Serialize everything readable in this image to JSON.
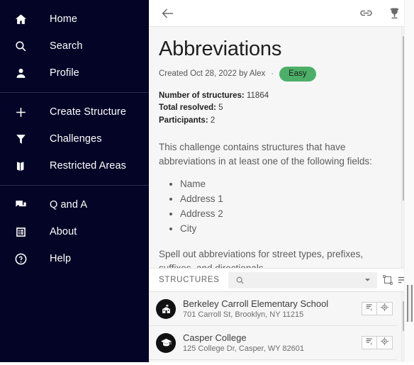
{
  "sidebar": {
    "groups": [
      {
        "items": [
          {
            "label": "Home",
            "icon": "home-icon"
          },
          {
            "label": "Search",
            "icon": "search-icon"
          },
          {
            "label": "Profile",
            "icon": "person-icon"
          }
        ]
      },
      {
        "items": [
          {
            "label": "Create Structure",
            "icon": "plus-icon"
          },
          {
            "label": "Challenges",
            "icon": "funnel-icon"
          },
          {
            "label": "Restricted Areas",
            "icon": "map-icon"
          }
        ]
      },
      {
        "items": [
          {
            "label": "Q and A",
            "icon": "chat-icon"
          },
          {
            "label": "About",
            "icon": "list-box-icon"
          },
          {
            "label": "Help",
            "icon": "help-circle-icon"
          }
        ]
      }
    ]
  },
  "topbar": {
    "back_icon": "back-arrow-icon",
    "link_icon": "link-icon",
    "trophy_icon": "trophy-icon"
  },
  "challenge": {
    "title": "Abbreviations",
    "created_text": "Created Oct 28, 2022 by Alex",
    "separator": "·",
    "difficulty": "Easy",
    "difficulty_color": "#4caf68",
    "stats": [
      {
        "label": "Number of structures:",
        "value": "11864"
      },
      {
        "label": "Total resolved:",
        "value": "5"
      },
      {
        "label": "Participants:",
        "value": "2"
      }
    ],
    "description_intro": "This challenge contains structures that have abbreviations in at least one of the following fields:",
    "fields": [
      "Name",
      "Address 1",
      "Address 2",
      "City"
    ],
    "description_outro": "Spell out abbreviations for street types, prefixes, suffixes, and directionals."
  },
  "structures": {
    "section_label": "STRUCTURES",
    "search_value": "",
    "search_placeholder": "",
    "search_icon": "search-icon",
    "dropdown_icon": "chevron-down-icon",
    "tools": [
      {
        "icon": "select-shape-icon"
      },
      {
        "icon": "sort-list-icon"
      },
      {
        "icon": "refresh-icon"
      }
    ],
    "rows": [
      {
        "icon": "school-building-icon",
        "name": "Berkeley Carroll Elementary School",
        "address": "701 Carroll St, Brooklyn, NY 11215",
        "actions": [
          {
            "icon": "remove-from-list-icon"
          },
          {
            "icon": "locate-crosshair-icon"
          }
        ]
      },
      {
        "icon": "graduation-cap-icon",
        "name": "Casper College",
        "address": "125 College Dr, Casper, WY 82601",
        "actions": [
          {
            "icon": "remove-from-list-icon"
          },
          {
            "icon": "locate-crosshair-icon"
          }
        ]
      }
    ]
  }
}
